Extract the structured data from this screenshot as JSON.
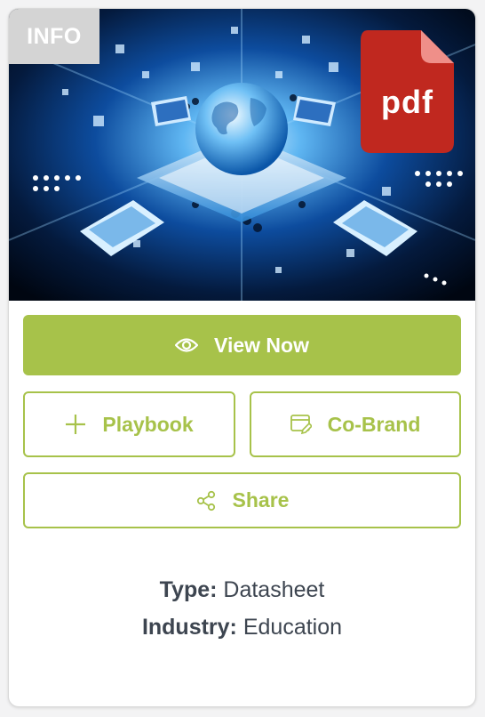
{
  "badge": {
    "label": "INFO"
  },
  "file_icon": {
    "label": "pdf",
    "color": "#c0281f",
    "fold_color": "#ef8f89"
  },
  "actions": {
    "view_label": "View Now",
    "playbook_label": "Playbook",
    "cobrand_label": "Co-Brand",
    "share_label": "Share"
  },
  "details": {
    "type_label": "Type:",
    "type_value": "Datasheet",
    "industry_label": "Industry:",
    "industry_value": "Education"
  },
  "colors": {
    "accent": "#a7c24a",
    "text": "#3d4550"
  },
  "icons": [
    "eye-icon",
    "plus-icon",
    "edit-document-icon",
    "share-icon",
    "pdf-file-icon"
  ]
}
